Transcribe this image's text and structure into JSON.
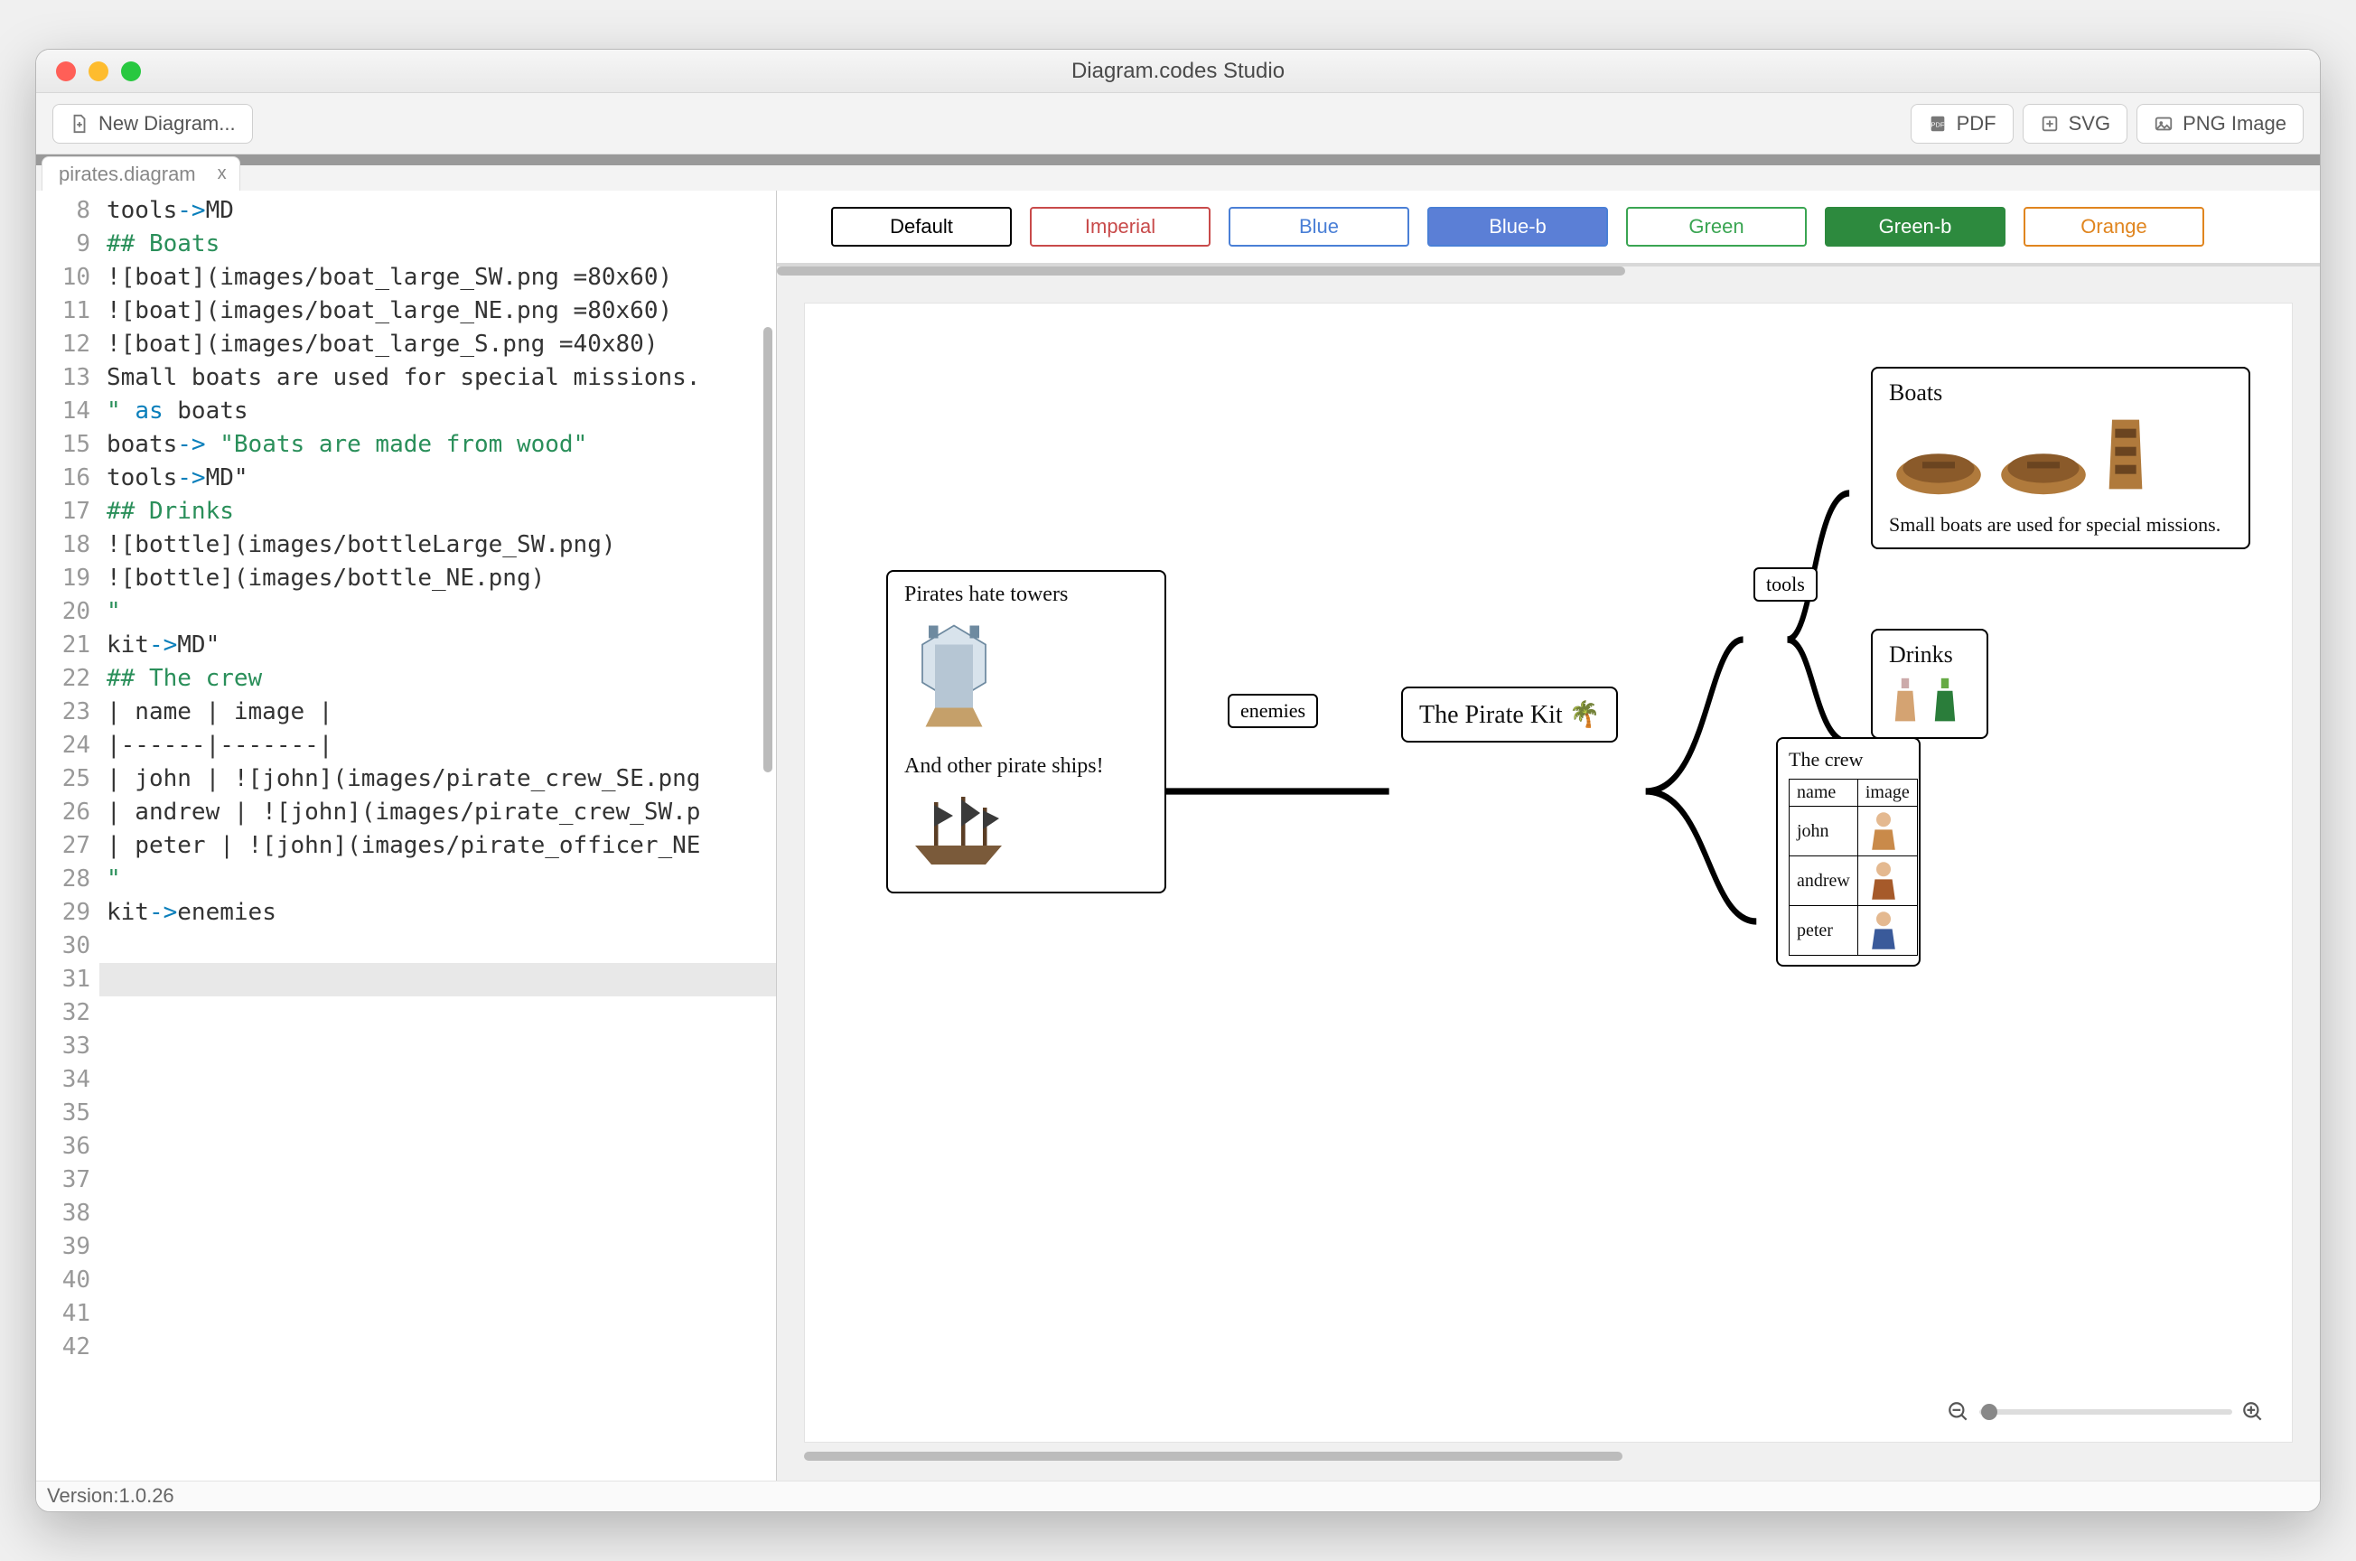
{
  "window": {
    "title": "Diagram.codes Studio"
  },
  "toolbar": {
    "new_diagram": "New Diagram...",
    "export_pdf": "PDF",
    "export_svg": "SVG",
    "export_png": "PNG Image"
  },
  "tab": {
    "label": "pirates.diagram",
    "close": "x"
  },
  "editor": {
    "first_line_no": 8,
    "active_line_no": 31,
    "lines": [
      {
        "n": 8,
        "text": "tools->MD",
        "seg": [
          [
            "tools",
            ""
          ],
          [
            "->",
            "op"
          ],
          [
            "MD",
            ""
          ]
        ]
      },
      {
        "n": 9,
        "text": ""
      },
      {
        "n": 10,
        "text": "## Boats",
        "seg": [
          [
            "## Boats",
            "cm"
          ]
        ]
      },
      {
        "n": 11,
        "text": ""
      },
      {
        "n": 12,
        "text": "![boat](images/boat_large_SW.png =80x60)"
      },
      {
        "n": 13,
        "text": "![boat](images/boat_large_NE.png =80x60)"
      },
      {
        "n": 14,
        "text": "![boat](images/boat_large_S.png =40x80)"
      },
      {
        "n": 15,
        "text": ""
      },
      {
        "n": 16,
        "text": "Small boats are used for special missions."
      },
      {
        "n": 17,
        "text": ""
      },
      {
        "n": 18,
        "text": "\" as boats",
        "seg": [
          [
            "\" ",
            "str"
          ],
          [
            "as",
            "kw"
          ],
          [
            " boats",
            ""
          ]
        ]
      },
      {
        "n": 19,
        "text": ""
      },
      {
        "n": 20,
        "text": "boats-> \"Boats are made from wood\"",
        "seg": [
          [
            "boats",
            ""
          ],
          [
            "-> ",
            "op"
          ],
          [
            "\"Boats are made from wood\"",
            "str"
          ]
        ]
      },
      {
        "n": 21,
        "text": ""
      },
      {
        "n": 22,
        "text": ""
      },
      {
        "n": 23,
        "text": "tools->MD\"",
        "seg": [
          [
            "tools",
            ""
          ],
          [
            "->",
            "op"
          ],
          [
            "MD\"",
            ""
          ]
        ]
      },
      {
        "n": 24,
        "text": "## Drinks",
        "seg": [
          [
            "## Drinks",
            "cm"
          ]
        ]
      },
      {
        "n": 25,
        "text": "![bottle](images/bottleLarge_SW.png)"
      },
      {
        "n": 26,
        "text": "![bottle](images/bottle_NE.png)"
      },
      {
        "n": 27,
        "text": "\"",
        "seg": [
          [
            "\"",
            "str"
          ]
        ]
      },
      {
        "n": 28,
        "text": ""
      },
      {
        "n": 29,
        "text": ""
      },
      {
        "n": 30,
        "text": "kit->MD\"",
        "seg": [
          [
            "kit",
            ""
          ],
          [
            "->",
            "op"
          ],
          [
            "MD\"",
            ""
          ]
        ]
      },
      {
        "n": 31,
        "text": ""
      },
      {
        "n": 32,
        "text": "## The crew",
        "seg": [
          [
            "## The crew",
            "cm"
          ]
        ]
      },
      {
        "n": 33,
        "text": ""
      },
      {
        "n": 34,
        "text": "| name | image |"
      },
      {
        "n": 35,
        "text": "|------|-------|"
      },
      {
        "n": 36,
        "text": "| john | ![john](images/pirate_crew_SE.png"
      },
      {
        "n": 37,
        "text": "| andrew | ![john](images/pirate_crew_SW.p"
      },
      {
        "n": 38,
        "text": "| peter | ![john](images/pirate_officer_NE"
      },
      {
        "n": 39,
        "text": ""
      },
      {
        "n": 40,
        "text": "\"",
        "seg": [
          [
            "\"",
            "str"
          ]
        ]
      },
      {
        "n": 41,
        "text": ""
      },
      {
        "n": 42,
        "text": "kit->enemies",
        "seg": [
          [
            "kit",
            ""
          ],
          [
            "->",
            "op"
          ],
          [
            "enemies",
            ""
          ]
        ]
      }
    ]
  },
  "themes": [
    {
      "id": "default",
      "label": "Default",
      "cls": "th-default"
    },
    {
      "id": "imperial",
      "label": "Imperial",
      "cls": "th-imperial"
    },
    {
      "id": "blue",
      "label": "Blue",
      "cls": "th-blue"
    },
    {
      "id": "blueb",
      "label": "Blue-b",
      "cls": "th-blueb"
    },
    {
      "id": "green",
      "label": "Green",
      "cls": "th-green"
    },
    {
      "id": "greenb",
      "label": "Green-b",
      "cls": "th-greenb"
    },
    {
      "id": "orange",
      "label": "Orange",
      "cls": "th-orange"
    }
  ],
  "diagram": {
    "root": {
      "label": "The Pirate Kit 🌴"
    },
    "edge_enemies": "enemies",
    "edge_tools": "tools",
    "enemies": {
      "line1": "Pirates hate towers",
      "line2": "And other pirate ships!"
    },
    "boats": {
      "title": "Boats",
      "caption": "Small boats are used for special missions."
    },
    "drinks": {
      "title": "Drinks"
    },
    "crew": {
      "title": "The crew",
      "table_headers": [
        "name",
        "image"
      ],
      "rows": [
        "john",
        "andrew",
        "peter"
      ]
    }
  },
  "status": {
    "version": "Version:1.0.26"
  }
}
